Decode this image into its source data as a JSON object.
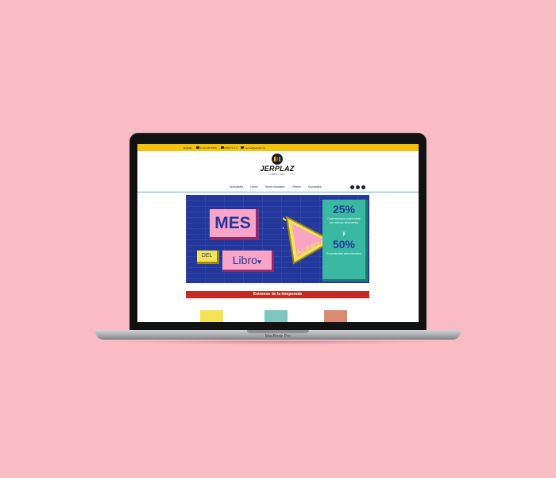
{
  "laptop": {
    "model": "MacBook Pro"
  },
  "site": {
    "topbar": {
      "schedule_label": "Horario",
      "phone1": "01 22 345 6789",
      "phone2": "0800 71 8 0",
      "email": "ventas@jerplaz.mx"
    },
    "logo": {
      "name": "JERPLAZ",
      "tagline": "LIBROS Y MÁS"
    },
    "nav": [
      "Novedades",
      "Libros",
      "Textos escolares",
      "Ofertas",
      "Sucursales"
    ],
    "socials": [
      "facebook-icon",
      "instagram-icon",
      "twitter-icon"
    ],
    "banner": {
      "word1": "MES",
      "word2": "DEL",
      "word3": "Libro",
      "alert": "ALERTA",
      "pct1": "25%",
      "note1": "Cada semana sorpréndete con nuevos descuentos",
      "amp": "y",
      "pct2": "50%",
      "note2": "En productos seleccionados"
    },
    "section_title": "Estrenos de la temporada"
  },
  "colors": {
    "background": "#f9bcc5",
    "topbar": "#f5c20a",
    "banner": "#23389a",
    "section_bar": "#c62b1f",
    "accent_teal": "#39b9a2"
  }
}
